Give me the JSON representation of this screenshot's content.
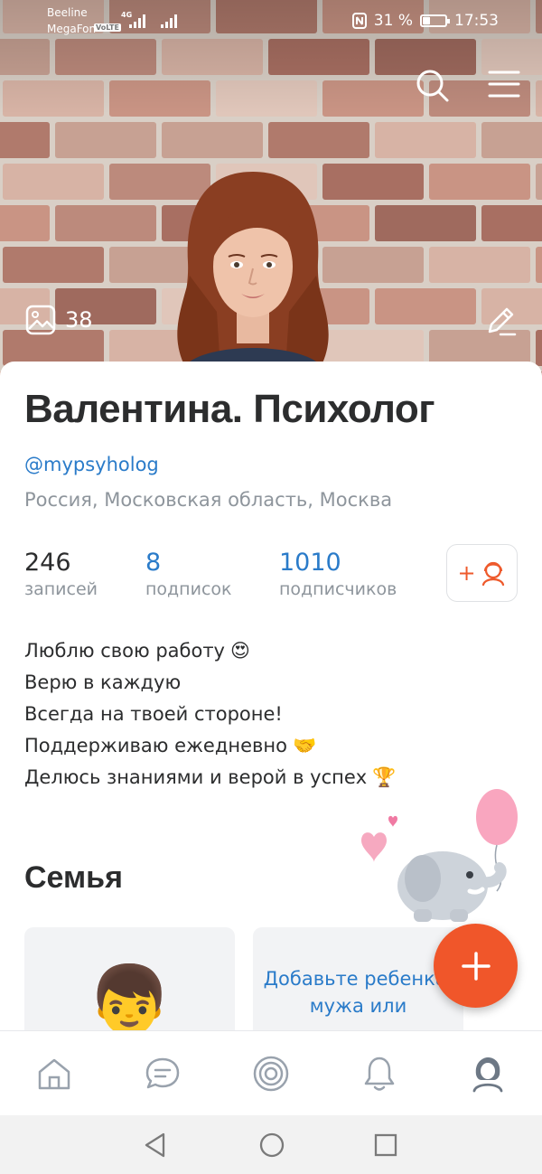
{
  "status_bar": {
    "carrier_1": "Beeline",
    "carrier_2": "MegaFon",
    "volte_badge": "VoLTE",
    "network_badge": "4G",
    "battery": "31 %",
    "time": "17:53"
  },
  "cover": {
    "photos_count": "38",
    "icons": [
      "search-icon",
      "menu-icon",
      "photos-icon",
      "edit-icon"
    ]
  },
  "profile": {
    "name": "Валентина. Психолог",
    "handle": "@mypsyholog",
    "location": "Россия, Московская область, Москва"
  },
  "stats": [
    {
      "value": "246",
      "label": "записей"
    },
    {
      "value": "8",
      "label": "подписок"
    },
    {
      "value": "1010",
      "label": "подписчиков"
    }
  ],
  "add_friend": {
    "plus": "+",
    "icon": "add-friend-icon"
  },
  "bio": {
    "line_1": "Люблю свою работу",
    "line_2": "Верю в каждую",
    "line_3": "Всегда на твоей стороне!",
    "line_4": "Поддерживаю ежедневно",
    "line_5": "Делюсь знаниями и верой в успех",
    "emoji_1": "😍",
    "emoji_4": "🤝",
    "emoji_5": "🏆"
  },
  "family": {
    "title": "Семья",
    "add_text": "Добавьте ребенка, мужа или",
    "member_emoji": "👦"
  },
  "tabbar": {
    "items": [
      "home-icon",
      "messages-icon",
      "discover-icon",
      "notifications-icon",
      "profile-icon"
    ],
    "active": "profile-icon"
  },
  "colors": {
    "accent": "#2a7bc9",
    "orange": "#f0562a",
    "muted": "#8e959c",
    "text": "#2c2d2e"
  }
}
